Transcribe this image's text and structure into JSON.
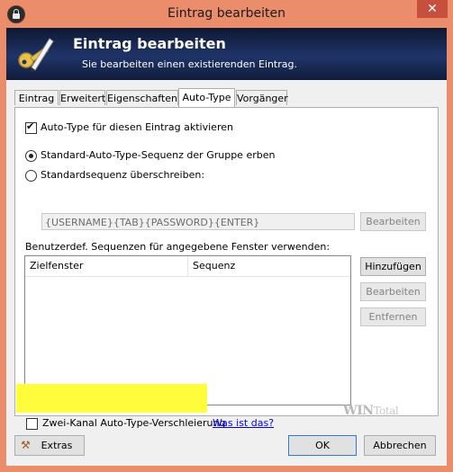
{
  "window": {
    "title": "Eintrag bearbeiten",
    "close_glyph": "✕"
  },
  "banner": {
    "title": "Eintrag bearbeiten",
    "subtitle": "Sie bearbeiten einen existierenden Eintrag."
  },
  "tabs": [
    {
      "label": "Eintrag",
      "active": false
    },
    {
      "label": "Erweitert",
      "active": false
    },
    {
      "label": "Eigenschaften",
      "active": false
    },
    {
      "label": "Auto-Type",
      "active": true
    },
    {
      "label": "Vorgänger",
      "active": false
    }
  ],
  "autotype": {
    "enable_label": "Auto-Type für diesen Eintrag aktivieren",
    "enable_checked": true,
    "inherit_label": "Standard-Auto-Type-Sequenz der Gruppe erben",
    "inherit_selected": true,
    "override_label": "Standardsequenz überschreiben:",
    "override_selected": false,
    "sequence_value": "{USERNAME}{TAB}{PASSWORD}{ENTER}",
    "edit_sequence_button": "Bearbeiten",
    "custom_label": "Benutzerdef. Sequenzen für angegebene Fenster verwenden:",
    "columns": [
      "Zielfenster",
      "Sequenz"
    ],
    "add_button": "Hinzufügen",
    "edit_button": "Bearbeiten",
    "remove_button": "Entfernen",
    "obfuscation_label": "Zwei-Kanal Auto-Type-Verschleierung",
    "obfuscation_checked": false,
    "help_link": "Was ist das?",
    "highlight_color": "#fffc3c"
  },
  "watermark": {
    "part1": "WIN",
    "part2": "Total"
  },
  "footer": {
    "extras_button": "Extras",
    "ok_button": "OK",
    "cancel_button": "Abbrechen"
  },
  "colors": {
    "titlebar": "#eb8d6a",
    "close": "#c7503c",
    "banner": "#1f3468",
    "link": "#0000ee"
  }
}
